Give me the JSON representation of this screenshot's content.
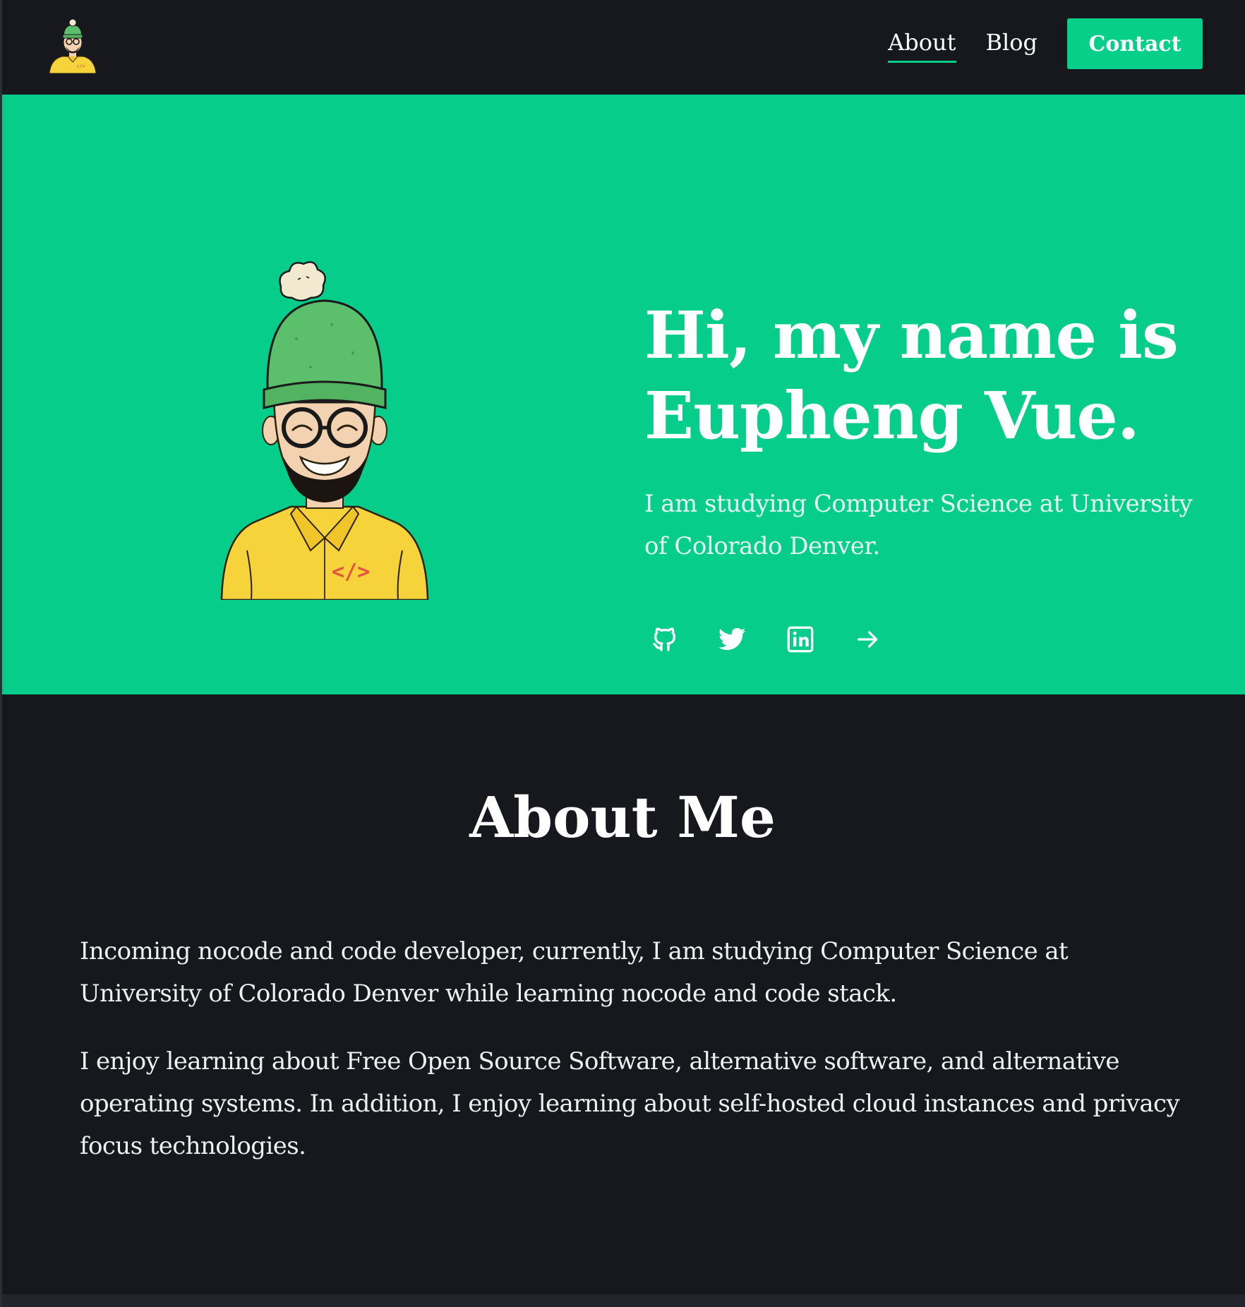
{
  "header": {
    "nav": [
      {
        "label": "About",
        "active": true
      },
      {
        "label": "Blog",
        "active": false
      }
    ],
    "contact_label": "Contact"
  },
  "hero": {
    "title_line1": "Hi, my name is",
    "title_line2": "Eupheng Vue.",
    "subtitle": "I am studying Computer Science at University of Colorado Denver.",
    "socials": [
      "github-icon",
      "twitter-icon",
      "linkedin-icon",
      "arrow-right-icon"
    ]
  },
  "about": {
    "title": "About Me",
    "paragraphs": [
      "Incoming nocode and code developer, currently, I am studying Computer Science at University of Colorado Denver while learning nocode and code stack.",
      "I enjoy learning about Free Open Source Software, alternative software, and alternative operating systems. In addition, I enjoy learning about self-hosted cloud instances and privacy focus technologies."
    ]
  },
  "colors": {
    "accent": "#06cd8a",
    "background": "#16181d",
    "shirt": "#f6d33a",
    "beanie": "#5cbf6b",
    "code_symbol": "#e5533d"
  }
}
